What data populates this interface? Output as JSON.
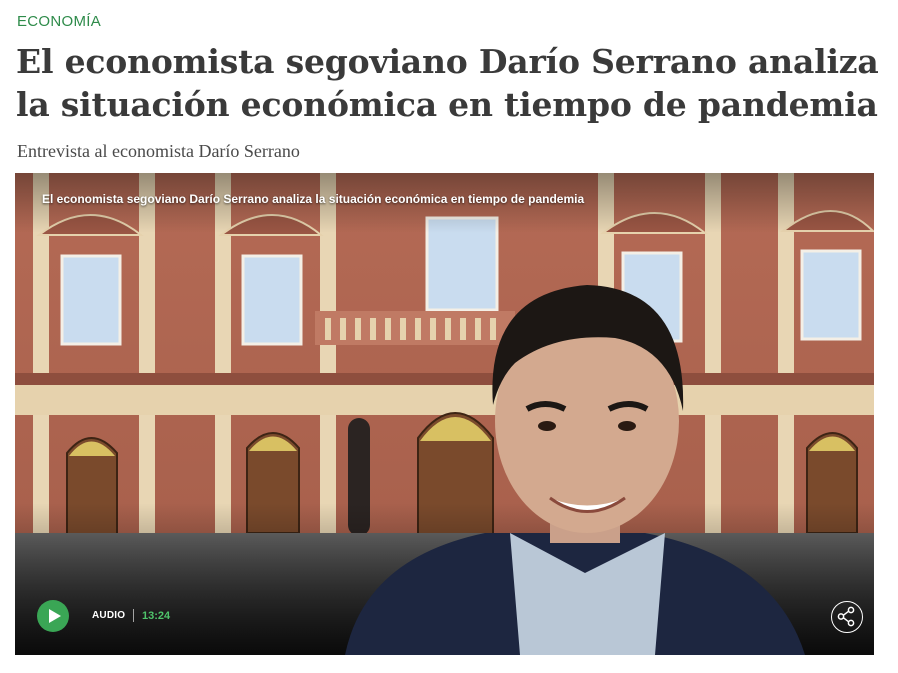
{
  "article": {
    "section": "ECONOMÍA",
    "headline": "El economista segoviano Darío Serrano analiza la situación económica en tiempo de pandemia",
    "subheadline": "Entrevista al economista Darío Serrano"
  },
  "player": {
    "title": "El economista segoviano Darío Serrano analiza la situación económica en tiempo de pandemia",
    "media_type": "AUDIO",
    "duration": "13:24",
    "play_icon": "play-icon",
    "share_icon": "share-icon"
  },
  "colors": {
    "accent_green": "#3aa655",
    "section_green": "#2e8b4a",
    "duration_green": "#4fc46b",
    "headline": "#3a3a3a"
  }
}
